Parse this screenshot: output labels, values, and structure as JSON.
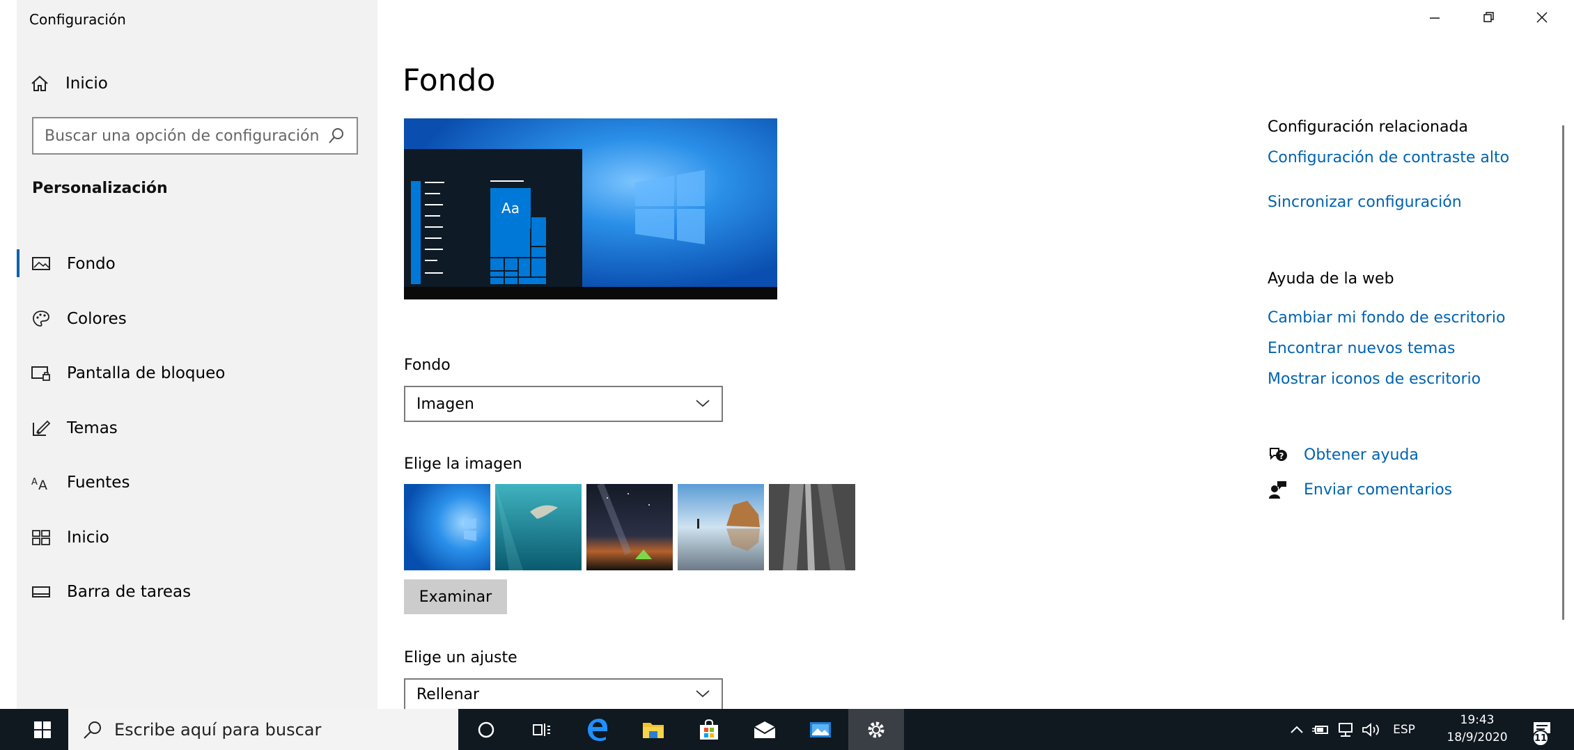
{
  "window": {
    "title": "Configuración",
    "minimize_glyph": "—",
    "restore_glyph": "❐",
    "close_glyph": "✕"
  },
  "sidebar": {
    "home_label": "Inicio",
    "search_placeholder": "Buscar una opción de configuración",
    "section_title": "Personalización",
    "items": [
      {
        "label": "Fondo",
        "icon": "picture-icon",
        "active": true
      },
      {
        "label": "Colores",
        "icon": "palette-icon",
        "active": false
      },
      {
        "label": "Pantalla de bloqueo",
        "icon": "lock-screen-icon",
        "active": false
      },
      {
        "label": "Temas",
        "icon": "brush-icon",
        "active": false
      },
      {
        "label": "Fuentes",
        "icon": "font-icon",
        "active": false
      },
      {
        "label": "Inicio",
        "icon": "start-tiles-icon",
        "active": false
      },
      {
        "label": "Barra de tareas",
        "icon": "taskbar-icon",
        "active": false
      }
    ]
  },
  "main": {
    "page_title": "Fondo",
    "preview_tile_text": "Aa",
    "background_label": "Fondo",
    "background_value": "Imagen",
    "choose_image_label": "Elige la imagen",
    "thumbnails": [
      "windows-blue-wallpaper",
      "underwater-swimmer",
      "night-sky-tent",
      "beach-rocks-reflection",
      "rock-cliff"
    ],
    "browse_button": "Examinar",
    "fit_label": "Elige un ajuste",
    "fit_value": "Rellenar"
  },
  "related": {
    "related_heading": "Configuración relacionada",
    "contrast_link": "Configuración de contraste alto",
    "sync_link": "Sincronizar configuración",
    "web_help_heading": "Ayuda de la web",
    "web_links": [
      "Cambiar mi fondo de escritorio",
      "Encontrar nuevos temas",
      "Mostrar iconos de escritorio"
    ],
    "get_help": "Obtener ayuda",
    "send_feedback": "Enviar comentarios"
  },
  "taskbar": {
    "search_placeholder": "Escribe aquí para buscar",
    "language": "ESP",
    "time": "19:43",
    "date": "18/9/2020",
    "notification_count": "11",
    "colors": {
      "accent": "#0078d7",
      "link": "#0063b1",
      "taskbar": "#101820"
    }
  }
}
